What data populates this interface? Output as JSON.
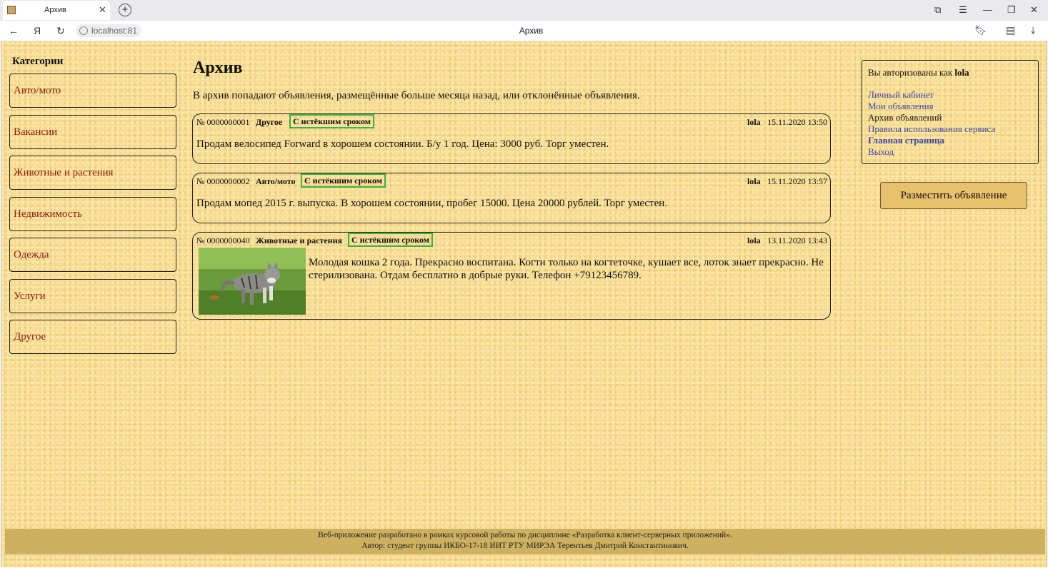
{
  "browser": {
    "tab_title": "Архив",
    "tab_close": "✕",
    "new_tab": "+",
    "url": "localhost:81",
    "page_title": "Архив",
    "nav_back": "←",
    "nav_ya": "Я",
    "nav_reload": "↻"
  },
  "sidebar": {
    "title": "Категории",
    "items": [
      {
        "label": "Авто/мото"
      },
      {
        "label": "Вакансии"
      },
      {
        "label": "Животные и растения"
      },
      {
        "label": "Недвижимость"
      },
      {
        "label": "Одежда"
      },
      {
        "label": "Услуги"
      },
      {
        "label": "Другое"
      }
    ]
  },
  "main": {
    "title": "Архив",
    "description": "В архив попадают объявления, размещённые больше месяца назад, или отклонённые объявления.",
    "ads": [
      {
        "number": "№ 0000000001",
        "category": "Другое",
        "badge": "С истёкшим сроком",
        "user": "lola",
        "date": "15.11.2020 13:50",
        "text": "Продам велосипед Forward в хорошем состоянии. Б/у 1 год. Цена: 3000 руб. Торг уместен."
      },
      {
        "number": "№ 0000000002",
        "category": "Авто/мото",
        "badge": "С истёкшим сроком",
        "user": "lola",
        "date": "15.11.2020 13:57",
        "text": "Продам мопед 2015 г. выпуска. В хорошем состоянии, пробег 15000. Цена 20000 рублей. Торг уместен."
      },
      {
        "number": "№ 0000000040",
        "category": "Животные и растения",
        "badge": "С истёкшим сроком",
        "user": "lola",
        "date": "13.11.2020 13:43",
        "text": "Молодая кошка 2 года. Прекрасно воспитана. Когти только на когтеточке, кушает все, лоток знает прекрасно. Не стерилизована. Отдам бесплатно в добрые руки. Телефон +79123456789."
      }
    ]
  },
  "userbox": {
    "auth_prefix": "Вы авторизованы как ",
    "username": "lola",
    "links": {
      "cabinet": "Личный кабинет",
      "my_ads": "Мои объявления",
      "archive": "Архив объявлений",
      "rules": "Правила использования сервиса",
      "home": "Главная страница",
      "logout": "Выход"
    }
  },
  "post_button": "Разместить объявление",
  "footer": {
    "line1": "Веб-приложение разработано в рамках курсовой работы по дисциплине «Разработка клиент-серверных приложений».",
    "line2": "Автор: студент группы ИКБО-17-18 ИИТ РТУ МИРЭА Терентьев Дмитрий Константинович."
  },
  "colors": {
    "page_bg": "#f7d98b",
    "category_link": "#8b1a10",
    "user_link": "#3b48a8",
    "badge_border": "#3cb043",
    "footer_bg": "#cdb060",
    "button_bg": "#e9c06c"
  }
}
